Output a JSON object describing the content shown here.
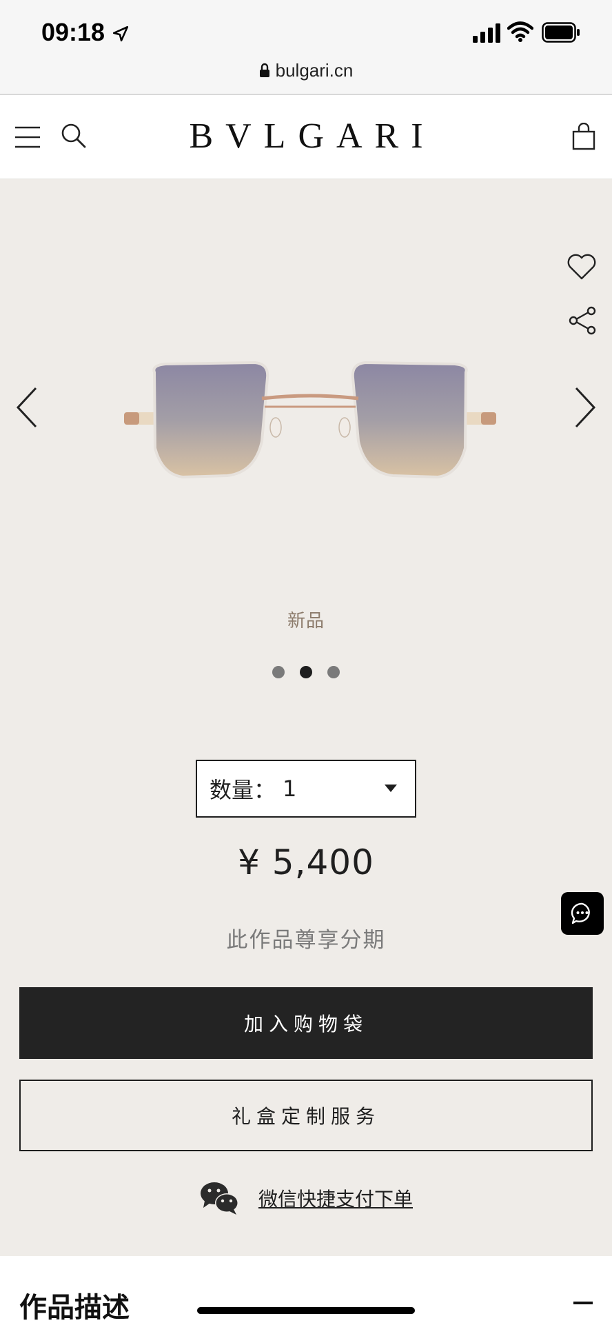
{
  "status_bar": {
    "time": "09:18",
    "url": "bulgari.cn",
    "icons": [
      "location-arrow-icon",
      "signal-icon",
      "wifi-icon",
      "battery-icon",
      "lock-icon"
    ]
  },
  "header": {
    "logo": "BVLGARI",
    "icons": [
      "menu-icon",
      "search-icon",
      "shopping-bag-icon"
    ]
  },
  "hero": {
    "icons": [
      "heart-icon",
      "share-icon",
      "chevron-left-icon",
      "chevron-right-icon"
    ],
    "badge": "新品",
    "carousel": {
      "total": 3,
      "active_index": 1
    }
  },
  "product": {
    "quantity_label": "数量：",
    "quantity_value": "1",
    "price": "¥ 5,400",
    "installment_text": "此作品尊享分期"
  },
  "actions": {
    "add_to_bag": "加入购物袋",
    "gift_box": "礼盒定制服务",
    "wechat_link": "微信快捷支付下单"
  },
  "description": {
    "title": "作品描述"
  },
  "colors": {
    "page_background": "#efece8",
    "primary_button": "#232323",
    "badge_text": "#8c7b6b"
  }
}
